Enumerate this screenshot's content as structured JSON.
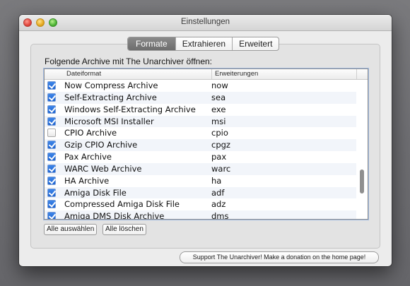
{
  "window": {
    "title": "Einstellungen"
  },
  "tabs": [
    {
      "label": "Formate",
      "active": true
    },
    {
      "label": "Extrahieren",
      "active": false
    },
    {
      "label": "Erweitert",
      "active": false
    }
  ],
  "formats": {
    "intro_label": "Folgende Archive mit The Unarchiver öffnen:",
    "columns": {
      "format": "Dateiformat",
      "extensions": "Erweiterungen"
    },
    "rows": [
      {
        "checked": true,
        "name": "Now Compress Archive",
        "ext": "now"
      },
      {
        "checked": true,
        "name": "Self-Extracting Archive",
        "ext": "sea"
      },
      {
        "checked": true,
        "name": "Windows Self-Extracting Archive",
        "ext": "exe"
      },
      {
        "checked": true,
        "name": "Microsoft MSI Installer",
        "ext": "msi"
      },
      {
        "checked": false,
        "name": "CPIO Archive",
        "ext": "cpio"
      },
      {
        "checked": true,
        "name": "Gzip CPIO Archive",
        "ext": "cpgz"
      },
      {
        "checked": true,
        "name": "Pax Archive",
        "ext": "pax"
      },
      {
        "checked": true,
        "name": "WARC Web Archive",
        "ext": "warc"
      },
      {
        "checked": true,
        "name": "HA Archive",
        "ext": "ha"
      },
      {
        "checked": true,
        "name": "Amiga Disk File",
        "ext": "adf"
      },
      {
        "checked": true,
        "name": "Compressed Amiga Disk File",
        "ext": "adz"
      },
      {
        "checked": true,
        "name": "Amiga DMS Disk Archive",
        "ext": "dms"
      }
    ],
    "select_all_label": "Alle auswählen",
    "clear_all_label": "Alle löschen"
  },
  "footer": {
    "support_label": "Support The Unarchiver! Make a donation on the home page!"
  },
  "colors": {
    "accent": "#2a6fdb",
    "active_tab": "#7a7a7a"
  }
}
